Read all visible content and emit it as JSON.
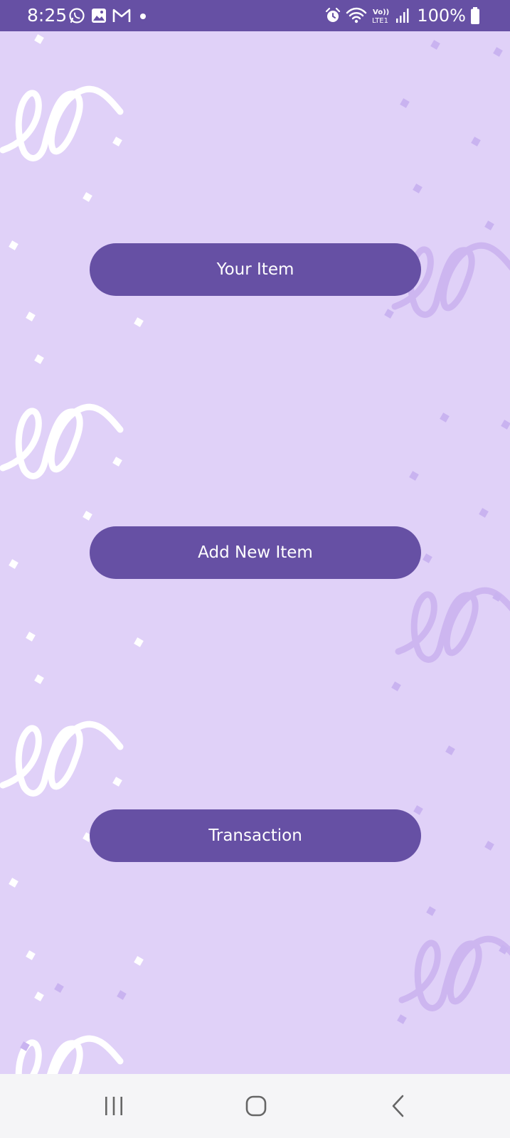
{
  "status_bar": {
    "time": "8:25",
    "battery": "100%",
    "left_icons": [
      "whatsapp-icon",
      "gallery-icon",
      "gmail-icon",
      "notification-dot-icon"
    ],
    "right_icons": [
      "alarm-icon",
      "wifi-icon",
      "volte-icon",
      "signal-icon",
      "battery-icon"
    ],
    "volte_label": "Vo)) LTE1"
  },
  "main": {
    "buttons": [
      {
        "label": "Your Item"
      },
      {
        "label": "Add New Item"
      },
      {
        "label": "Transaction"
      }
    ]
  },
  "nav_bar": {
    "items": [
      "recents-icon",
      "home-icon",
      "back-icon"
    ]
  },
  "colors": {
    "primary": "#6650a4",
    "background": "#e0d1f8",
    "swirl_light": "#ffffff",
    "swirl_dark": "#c9b3f0",
    "nav_background": "#f5f5f7"
  }
}
